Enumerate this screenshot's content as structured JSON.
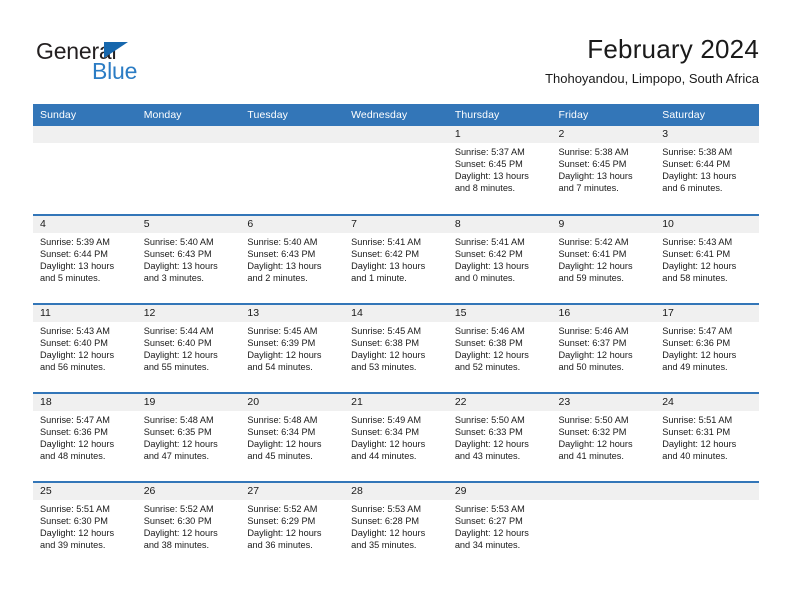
{
  "brand": {
    "name_top": "General",
    "name_bottom": "Blue",
    "accent_color": "#2b7cc4",
    "triangle_color": "#1667ad"
  },
  "header": {
    "title": "February 2024",
    "subtitle": "Thohoyandou, Limpopo, South Africa"
  },
  "theme": {
    "header_bg": "#3376b8",
    "header_text": "#ffffff",
    "daynum_band_bg": "#f0f0f0",
    "body_text": "#1a1a1a"
  },
  "weekday_headers": [
    "Sunday",
    "Monday",
    "Tuesday",
    "Wednesday",
    "Thursday",
    "Friday",
    "Saturday"
  ],
  "weeks": [
    [
      {
        "day": "",
        "lines": []
      },
      {
        "day": "",
        "lines": []
      },
      {
        "day": "",
        "lines": []
      },
      {
        "day": "",
        "lines": []
      },
      {
        "day": "1",
        "lines": [
          "Sunrise: 5:37 AM",
          "Sunset: 6:45 PM",
          "Daylight: 13 hours",
          "and 8 minutes."
        ]
      },
      {
        "day": "2",
        "lines": [
          "Sunrise: 5:38 AM",
          "Sunset: 6:45 PM",
          "Daylight: 13 hours",
          "and 7 minutes."
        ]
      },
      {
        "day": "3",
        "lines": [
          "Sunrise: 5:38 AM",
          "Sunset: 6:44 PM",
          "Daylight: 13 hours",
          "and 6 minutes."
        ]
      }
    ],
    [
      {
        "day": "4",
        "lines": [
          "Sunrise: 5:39 AM",
          "Sunset: 6:44 PM",
          "Daylight: 13 hours",
          "and 5 minutes."
        ]
      },
      {
        "day": "5",
        "lines": [
          "Sunrise: 5:40 AM",
          "Sunset: 6:43 PM",
          "Daylight: 13 hours",
          "and 3 minutes."
        ]
      },
      {
        "day": "6",
        "lines": [
          "Sunrise: 5:40 AM",
          "Sunset: 6:43 PM",
          "Daylight: 13 hours",
          "and 2 minutes."
        ]
      },
      {
        "day": "7",
        "lines": [
          "Sunrise: 5:41 AM",
          "Sunset: 6:42 PM",
          "Daylight: 13 hours",
          "and 1 minute."
        ]
      },
      {
        "day": "8",
        "lines": [
          "Sunrise: 5:41 AM",
          "Sunset: 6:42 PM",
          "Daylight: 13 hours",
          "and 0 minutes."
        ]
      },
      {
        "day": "9",
        "lines": [
          "Sunrise: 5:42 AM",
          "Sunset: 6:41 PM",
          "Daylight: 12 hours",
          "and 59 minutes."
        ]
      },
      {
        "day": "10",
        "lines": [
          "Sunrise: 5:43 AM",
          "Sunset: 6:41 PM",
          "Daylight: 12 hours",
          "and 58 minutes."
        ]
      }
    ],
    [
      {
        "day": "11",
        "lines": [
          "Sunrise: 5:43 AM",
          "Sunset: 6:40 PM",
          "Daylight: 12 hours",
          "and 56 minutes."
        ]
      },
      {
        "day": "12",
        "lines": [
          "Sunrise: 5:44 AM",
          "Sunset: 6:40 PM",
          "Daylight: 12 hours",
          "and 55 minutes."
        ]
      },
      {
        "day": "13",
        "lines": [
          "Sunrise: 5:45 AM",
          "Sunset: 6:39 PM",
          "Daylight: 12 hours",
          "and 54 minutes."
        ]
      },
      {
        "day": "14",
        "lines": [
          "Sunrise: 5:45 AM",
          "Sunset: 6:38 PM",
          "Daylight: 12 hours",
          "and 53 minutes."
        ]
      },
      {
        "day": "15",
        "lines": [
          "Sunrise: 5:46 AM",
          "Sunset: 6:38 PM",
          "Daylight: 12 hours",
          "and 52 minutes."
        ]
      },
      {
        "day": "16",
        "lines": [
          "Sunrise: 5:46 AM",
          "Sunset: 6:37 PM",
          "Daylight: 12 hours",
          "and 50 minutes."
        ]
      },
      {
        "day": "17",
        "lines": [
          "Sunrise: 5:47 AM",
          "Sunset: 6:36 PM",
          "Daylight: 12 hours",
          "and 49 minutes."
        ]
      }
    ],
    [
      {
        "day": "18",
        "lines": [
          "Sunrise: 5:47 AM",
          "Sunset: 6:36 PM",
          "Daylight: 12 hours",
          "and 48 minutes."
        ]
      },
      {
        "day": "19",
        "lines": [
          "Sunrise: 5:48 AM",
          "Sunset: 6:35 PM",
          "Daylight: 12 hours",
          "and 47 minutes."
        ]
      },
      {
        "day": "20",
        "lines": [
          "Sunrise: 5:48 AM",
          "Sunset: 6:34 PM",
          "Daylight: 12 hours",
          "and 45 minutes."
        ]
      },
      {
        "day": "21",
        "lines": [
          "Sunrise: 5:49 AM",
          "Sunset: 6:34 PM",
          "Daylight: 12 hours",
          "and 44 minutes."
        ]
      },
      {
        "day": "22",
        "lines": [
          "Sunrise: 5:50 AM",
          "Sunset: 6:33 PM",
          "Daylight: 12 hours",
          "and 43 minutes."
        ]
      },
      {
        "day": "23",
        "lines": [
          "Sunrise: 5:50 AM",
          "Sunset: 6:32 PM",
          "Daylight: 12 hours",
          "and 41 minutes."
        ]
      },
      {
        "day": "24",
        "lines": [
          "Sunrise: 5:51 AM",
          "Sunset: 6:31 PM",
          "Daylight: 12 hours",
          "and 40 minutes."
        ]
      }
    ],
    [
      {
        "day": "25",
        "lines": [
          "Sunrise: 5:51 AM",
          "Sunset: 6:30 PM",
          "Daylight: 12 hours",
          "and 39 minutes."
        ]
      },
      {
        "day": "26",
        "lines": [
          "Sunrise: 5:52 AM",
          "Sunset: 6:30 PM",
          "Daylight: 12 hours",
          "and 38 minutes."
        ]
      },
      {
        "day": "27",
        "lines": [
          "Sunrise: 5:52 AM",
          "Sunset: 6:29 PM",
          "Daylight: 12 hours",
          "and 36 minutes."
        ]
      },
      {
        "day": "28",
        "lines": [
          "Sunrise: 5:53 AM",
          "Sunset: 6:28 PM",
          "Daylight: 12 hours",
          "and 35 minutes."
        ]
      },
      {
        "day": "29",
        "lines": [
          "Sunrise: 5:53 AM",
          "Sunset: 6:27 PM",
          "Daylight: 12 hours",
          "and 34 minutes."
        ]
      },
      {
        "day": "",
        "lines": []
      },
      {
        "day": "",
        "lines": []
      }
    ]
  ]
}
